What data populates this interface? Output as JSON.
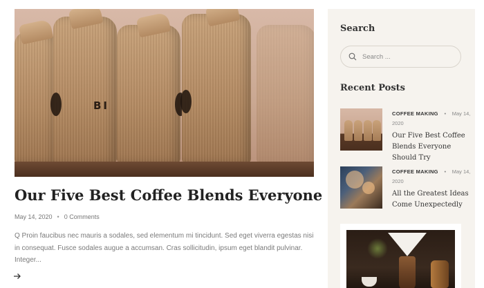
{
  "post": {
    "title": "Our Five Best Coffee Blends Everyone Should Try",
    "date": "May 14, 2020",
    "comments": "0 Comments",
    "excerpt": "Q Proin faucibus nec mauris a sodales, sed elementum mi tincidunt. Sed eget viverra egestas nisi in consequat. Fusce sodales augue a accumsan. Cras sollicitudin, ipsum eget blandit pulvinar. Integer...",
    "read_more_icon": "arrow-right-icon",
    "image_logo_text": "BI"
  },
  "sidebar": {
    "search": {
      "title": "Search",
      "placeholder": "Search ...",
      "value": ""
    },
    "recent": {
      "title": "Recent Posts",
      "items": [
        {
          "category": "COFFEE MAKING",
          "date": "May 14, 2020",
          "title": "Our Five Best Coffee Blends Everyone Should Try"
        },
        {
          "category": "COFFEE MAKING",
          "date": "May 14, 2020",
          "title": "All the Greatest Ideas Come Unexpectedly"
        }
      ]
    }
  },
  "colors": {
    "sidebar_bg": "#f6f3ee",
    "text": "#333333",
    "muted": "#7a7a7a"
  }
}
